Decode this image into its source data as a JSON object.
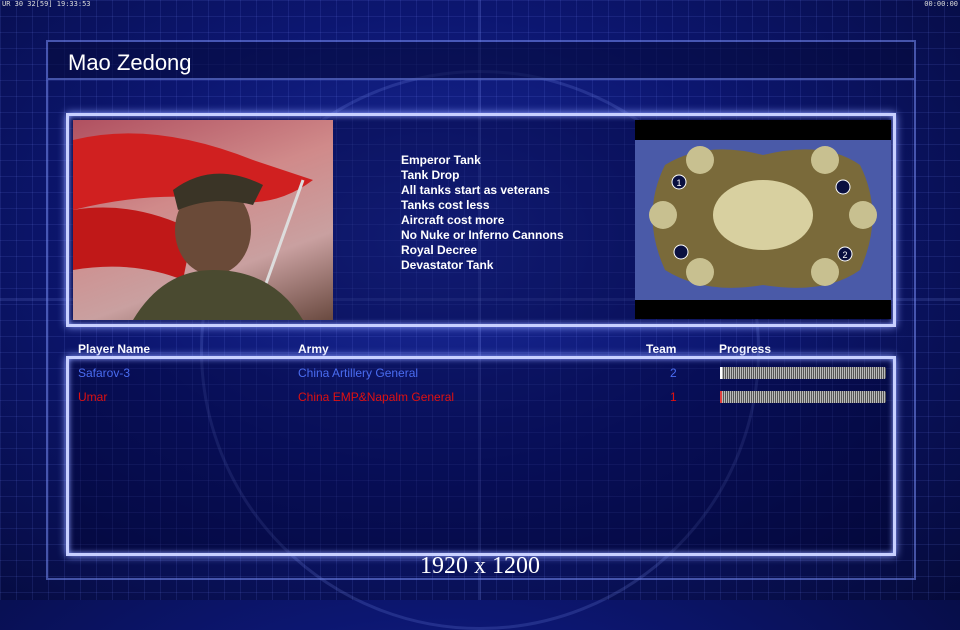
{
  "status_bar": {
    "left": "UR 30 32[59] 19:33:53",
    "right": "00:00:00"
  },
  "general_name": "Mao Zedong",
  "traits": [
    "Emperor Tank",
    "Tank Drop",
    "All tanks start as veterans",
    "Tanks cost less",
    "Aircraft cost more",
    "No Nuke or Inferno Cannons",
    "Royal Decree",
    "Devastator Tank"
  ],
  "map": {
    "start_positions": [
      "1",
      "2"
    ]
  },
  "table": {
    "headers": {
      "player": "Player Name",
      "army": "Army",
      "team": "Team",
      "progress": "Progress"
    },
    "rows": [
      {
        "player": "Safarov-3",
        "army": "China Artillery General",
        "team": "2",
        "progress": 0.01,
        "color": "#4a6cf0"
      },
      {
        "player": "Umar",
        "army": "China EMP&Napalm General",
        "team": "1",
        "progress": 0.01,
        "color": "#e01010"
      }
    ]
  },
  "resolution_label": "1920 x 1200"
}
